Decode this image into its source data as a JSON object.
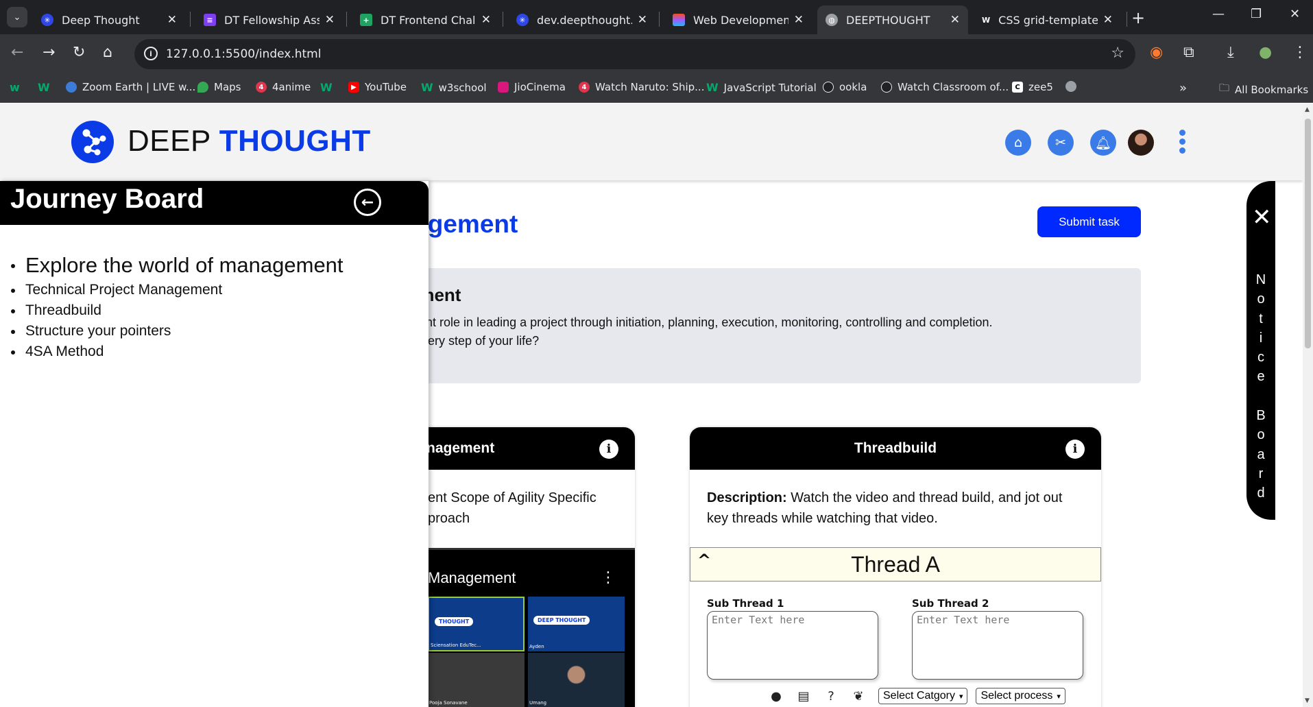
{
  "browser": {
    "tabs": [
      {
        "title": "Deep Thought",
        "active": false
      },
      {
        "title": "DT Fellowship Assign",
        "active": false
      },
      {
        "title": "DT Frontend Challeng",
        "active": false
      },
      {
        "title": "dev.deepthought.edu",
        "active": false
      },
      {
        "title": "Web Development A",
        "active": false
      },
      {
        "title": "DEEPTHOUGHT",
        "active": true
      },
      {
        "title": "CSS grid-template-co",
        "active": false
      }
    ],
    "url": "127.0.0.1:5500/index.html",
    "bookmarks": [
      {
        "label": "Zoom Earth | LIVE w..."
      },
      {
        "label": "Maps"
      },
      {
        "label": "4anime"
      },
      {
        "label": "YouTube"
      },
      {
        "label": "w3school"
      },
      {
        "label": "JioCinema"
      },
      {
        "label": "Watch Naruto: Ship..."
      },
      {
        "label": "JavaScript Tutorial"
      },
      {
        "label": "ookla"
      },
      {
        "label": "Watch Classroom of..."
      },
      {
        "label": "zee5"
      }
    ],
    "all_bookmarks": "All Bookmarks",
    "overflow": "»"
  },
  "header": {
    "brand_part1": "DEEP",
    "brand_part2": "THOUGHT"
  },
  "page": {
    "title_fragment": "anagement",
    "submit_label": "Submit task",
    "intro_heading_fragment": "gement",
    "intro_line1": "portant role in leading a project through initiation, planning, execution, monitoring, controlling and completion.",
    "intro_line2": "nd every step of your life?"
  },
  "cards": {
    "card1": {
      "title_fragment": "t Management",
      "desc_line1": "ent Scope of Agility Specific",
      "desc_line2": "proach",
      "video_title": "Management",
      "tiles": [
        {
          "tag": "THOUGHT",
          "name": "Sciensation EduTec..."
        },
        {
          "tag": "DEEP THOUGHT",
          "name": "Ayden"
        },
        {
          "tag": "",
          "name": "Pooja Sonavane"
        },
        {
          "tag": "",
          "name": "Umang"
        }
      ]
    },
    "card2": {
      "title": "Threadbuild",
      "desc_label": "Description:",
      "desc_text": " Watch the video and thread build, and jot out key threads while watching that video.",
      "thread_title": "Thread A",
      "sub1_label": "Sub Thread 1",
      "sub2_label": "Sub Thread 2",
      "placeholder": "Enter Text here",
      "select_category": "Select Catgory",
      "select_process": "Select process"
    }
  },
  "journey": {
    "title": "Journey Board",
    "items": [
      "Explore the world of management",
      "Technical Project Management",
      "Threadbuild",
      "Structure your pointers",
      "4SA Method"
    ]
  },
  "notice": {
    "letters": [
      "N",
      "o",
      "t",
      "i",
      "c",
      "e",
      "",
      "B",
      "o",
      "a",
      "r",
      "d"
    ]
  },
  "colors": {
    "brand_blue": "#0b3be6",
    "submit_blue": "#0029ff",
    "header_icon_blue": "#3a7be8"
  }
}
